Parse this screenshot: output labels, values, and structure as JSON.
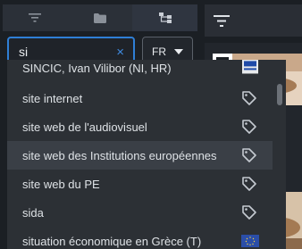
{
  "left_tabs": [
    {
      "icon": "filter-icon",
      "active": false
    },
    {
      "icon": "folder-icon",
      "active": false
    },
    {
      "icon": "hierarchy-icon",
      "active": true
    }
  ],
  "search": {
    "value": "si",
    "clear_symbol": "×"
  },
  "language": {
    "selected": "FR"
  },
  "suggestions": [
    {
      "label": "SINCIC, Ivan Vilibor (NI, HR)",
      "icon": "person-badge-icon"
    },
    {
      "label": "site internet",
      "icon": "tag-icon"
    },
    {
      "label": "site web de l'audiovisuel",
      "icon": "tag-icon"
    },
    {
      "label": "site web des Institutions européennes",
      "icon": "tag-icon",
      "highlighted": true
    },
    {
      "label": "site web du PE",
      "icon": "tag-icon"
    },
    {
      "label": "sida",
      "icon": "tag-icon"
    },
    {
      "label": "situation économique en Grèce (T)",
      "icon": "eu-flag-icon"
    }
  ],
  "colors": {
    "accent": "#2f7fd6",
    "panel": "#2c3035",
    "highlight": "#3a3f46",
    "text": "#dee2e6"
  }
}
